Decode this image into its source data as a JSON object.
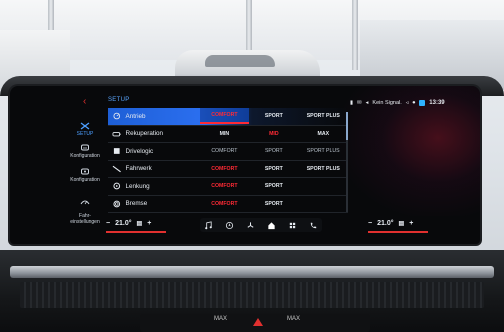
{
  "sidebar": {
    "back_label": "‹",
    "items": [
      {
        "label": "SETUP",
        "icon": "setup-icon",
        "active": true
      },
      {
        "label": "Konfiguration",
        "icon": "profile-config-icon",
        "active": false
      },
      {
        "label": "Konfiguration",
        "icon": "car-config-icon",
        "active": false
      },
      {
        "label": "Fahr-\neinstellungen",
        "icon": "driving-settings-icon",
        "active": false
      }
    ]
  },
  "header": {
    "title": "SETUP"
  },
  "status_bar": {
    "signal_text": "Kein Signal.",
    "time": "13:39"
  },
  "settings": [
    {
      "label": "Antrieb",
      "icon": "drive-icon",
      "selected": true,
      "options": [
        {
          "text": "COMFORT",
          "style": "red"
        },
        {
          "text": "SPORT",
          "style": "normal"
        },
        {
          "text": "SPORT PLUS",
          "style": "normal"
        }
      ]
    },
    {
      "label": "Rekuperation",
      "icon": "recuperation-icon",
      "selected": false,
      "options": [
        {
          "text": "MIN",
          "style": "normal"
        },
        {
          "text": "MID",
          "style": "red"
        },
        {
          "text": "MAX",
          "style": "normal"
        }
      ]
    },
    {
      "label": "Drivelogic",
      "icon": "drivelogic-icon",
      "selected": false,
      "options": [
        {
          "text": "COMFORT",
          "style": "muted"
        },
        {
          "text": "SPORT",
          "style": "muted"
        },
        {
          "text": "SPORT PLUS",
          "style": "muted"
        }
      ]
    },
    {
      "label": "Fahrwerk",
      "icon": "chassis-icon",
      "selected": false,
      "options": [
        {
          "text": "COMFORT",
          "style": "red"
        },
        {
          "text": "SPORT",
          "style": "normal"
        },
        {
          "text": "SPORT PLUS",
          "style": "normal"
        }
      ]
    },
    {
      "label": "Lenkung",
      "icon": "steering-icon",
      "selected": false,
      "options": [
        {
          "text": "COMFORT",
          "style": "red"
        },
        {
          "text": "SPORT",
          "style": "normal"
        },
        {
          "text": "",
          "style": "normal"
        }
      ]
    },
    {
      "label": "Bremse",
      "icon": "brake-icon",
      "selected": false,
      "options": [
        {
          "text": "COMFORT",
          "style": "red"
        },
        {
          "text": "SPORT",
          "style": "normal"
        },
        {
          "text": "",
          "style": "normal"
        }
      ]
    }
  ],
  "climate": {
    "left_temp": "21.0°",
    "right_temp": "21.0°",
    "minus": "−",
    "plus": "+"
  },
  "dock_icons": [
    "music-icon",
    "navigation-icon",
    "fan-icon",
    "home-icon",
    "apps-icon",
    "phone-icon"
  ],
  "dashboard_labels": {
    "left": "MAX",
    "right": "MAX"
  },
  "colors": {
    "accent_blue": "#2b6ff0",
    "accent_red": "#ff2a35",
    "text": "#e6ebf1"
  }
}
